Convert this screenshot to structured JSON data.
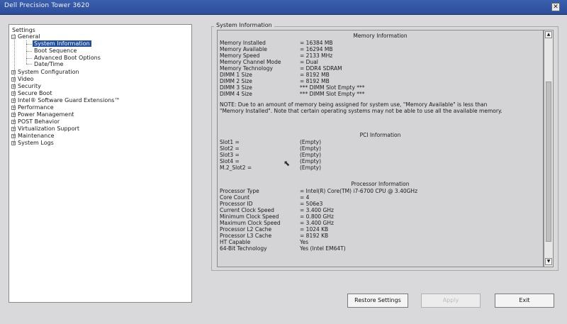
{
  "window": {
    "title": "Dell Precision Tower 3620",
    "close_glyph": "✕"
  },
  "tree": {
    "root": "Settings",
    "general": {
      "label": "General",
      "children": [
        "System Information",
        "Boot Sequence",
        "Advanced Boot Options",
        "Date/Time"
      ]
    },
    "items": [
      "System Configuration",
      "Video",
      "Security",
      "Secure Boot",
      "Intel® Software Guard Extensions™",
      "Performance",
      "Power Management",
      "POST Behavior",
      "Virtualization Support",
      "Maintenance",
      "System Logs"
    ],
    "expand_glyph": "+",
    "collapse_glyph": "−"
  },
  "group": {
    "title": "System Information"
  },
  "memory": {
    "heading": "Memory Information",
    "rows": [
      {
        "label": "Memory Installed",
        "value": "= 16384 MB"
      },
      {
        "label": "Memory Available",
        "value": "= 16294 MB"
      },
      {
        "label": "Memory Speed",
        "value": "= 2133 MHz"
      },
      {
        "label": "Memory Channel Mode",
        "value": "= Dual"
      },
      {
        "label": "Memory Technology",
        "value": "= DDR4 SDRAM"
      },
      {
        "label": "DIMM 1 Size",
        "value": "= 8192 MB"
      },
      {
        "label": "DIMM 2 Size",
        "value": "= 8192 MB"
      },
      {
        "label": "DIMM 3 Size",
        "value": "*** DIMM Slot Empty ***"
      },
      {
        "label": "DIMM 4 Size",
        "value": "*** DIMM Slot Empty ***"
      }
    ],
    "note": "NOTE: Due to an amount of memory being assigned for system use, \"Memory Available\" is less than \"Memory Installed\". Note that certain operating systems may not be able to use all the available memory."
  },
  "pci": {
    "heading": "PCI Information",
    "rows": [
      {
        "label": "Slot1 =",
        "value": "(Empty)"
      },
      {
        "label": "Slot2 =",
        "value": "(Empty)"
      },
      {
        "label": "Slot3 =",
        "value": "(Empty)"
      },
      {
        "label": "Slot4 =",
        "value": "(Empty)"
      },
      {
        "label": "M.2_Slot2 =",
        "value": "(Empty)"
      }
    ]
  },
  "processor": {
    "heading": "Processor Information",
    "rows": [
      {
        "label": "Processor Type",
        "value": "= Intel(R) Core(TM) i7-6700 CPU @ 3.40GHz"
      },
      {
        "label": "Core Count",
        "value": "= 4"
      },
      {
        "label": "Processor ID",
        "value": "= 506e3"
      },
      {
        "label": "Current Clock Speed",
        "value": "= 3.400 GHz"
      },
      {
        "label": "Minimum Clock Speed",
        "value": "= 0.800 GHz"
      },
      {
        "label": "Maximum Clock Speed",
        "value": "= 3.400 GHz"
      },
      {
        "label": "Processor L2 Cache",
        "value": "= 1024 KB"
      },
      {
        "label": "Processor L3 Cache",
        "value": "= 8192 KB"
      },
      {
        "label": "HT Capable",
        "value": "Yes"
      },
      {
        "label": "64-Bit Technology",
        "value": "Yes (Intel EM64T)"
      }
    ]
  },
  "scrollbar": {
    "up_glyph": "▲",
    "down_glyph": "▼"
  },
  "buttons": {
    "restore": "Restore Settings",
    "apply": "Apply",
    "exit": "Exit"
  },
  "cursor_glyph": "⬉"
}
